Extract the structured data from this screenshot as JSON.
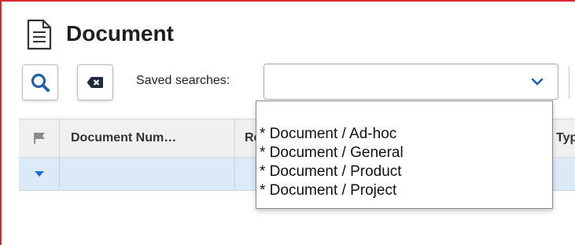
{
  "page": {
    "title": "Document"
  },
  "toolbar": {
    "search_icon": "search-icon",
    "clear_icon": "backspace-clear-icon",
    "saved_searches_label": "Saved searches:",
    "saved_searches_value": ""
  },
  "grid": {
    "headers": [
      "Document Num…",
      "Re…",
      "Typ"
    ],
    "flag_icon": "flag-icon",
    "row_expand_icon": "triangle-down-icon"
  },
  "dropdown": {
    "options": [
      "* Document / Ad-hoc",
      "* Document / General",
      "* Document / Product",
      "* Document / Project"
    ]
  },
  "colors": {
    "accent": "#1f5fa8",
    "frame": "#d8282b",
    "row_selected": "#dce9f7"
  }
}
